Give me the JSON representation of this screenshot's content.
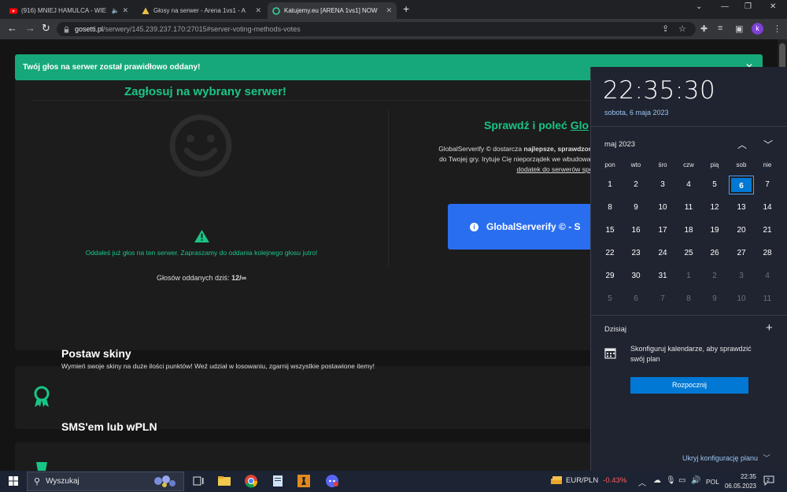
{
  "browser": {
    "tabs": [
      {
        "title": "(916) MNIEJ HAMULCA - WIE",
        "icon": "youtube-icon"
      },
      {
        "title": "Głosy na serwer - Arena 1vs1 - A",
        "icon": "warning-favicon-icon"
      },
      {
        "title": "Katujemy.eu [ARENA 1vs1] NOW",
        "icon": "katujemy-favicon-icon"
      }
    ],
    "url_host": "gosetti.pl",
    "url_path": "/serwery/145.239.237.170:27015#server-voting-methods-votes",
    "profile_initial": "k"
  },
  "alert": {
    "text": "Twój głos na serwer został prawidłowo oddany!"
  },
  "vote_panel": {
    "title": "Zagłosuj na wybrany serwer!",
    "voted_message": "Oddałeś już głos na ten serwer. Zapraszamy do oddania kolejnego głosu jutro!",
    "counter_label": "Głosów oddanych dziś:",
    "counter_value": "12/∞"
  },
  "globalserverify": {
    "title_prefix": "Sprawdź i poleć",
    "title_link": "Glo",
    "desc_1": "GlobalServerify © dostarcza",
    "desc_bold": "najlepsze, sprawdzone,",
    "desc_2": "do Twojej gry. Irytuje Cię nieporządek we wbudowane",
    "desc_link": "dodatek do serwerów społe",
    "button_label": "GlobalServerify © - S"
  },
  "skins": {
    "title": "Postaw skiny",
    "description": "Wymień swoje skiny na duże ilości punktów! Weź udział w losowaniu, zgarnij wszystkie postawione itemy!"
  },
  "sms": {
    "title": "SMS'em lub wPLN"
  },
  "calendar_flyout": {
    "time": "22:35:30",
    "date": "sobota, 6 maja 2023",
    "month_label": "maj 2023",
    "weekdays": [
      "pon",
      "wto",
      "śro",
      "czw",
      "pią",
      "sob",
      "nie"
    ],
    "days": [
      [
        "1",
        "2",
        "3",
        "4",
        "5",
        "6",
        "7"
      ],
      [
        "8",
        "9",
        "10",
        "11",
        "12",
        "13",
        "14"
      ],
      [
        "15",
        "16",
        "17",
        "18",
        "19",
        "20",
        "21"
      ],
      [
        "22",
        "23",
        "24",
        "25",
        "26",
        "27",
        "28"
      ],
      [
        "29",
        "30",
        "31",
        "1",
        "2",
        "3",
        "4"
      ],
      [
        "5",
        "6",
        "7",
        "8",
        "9",
        "10",
        "11"
      ]
    ],
    "today_label": "Dzisiaj",
    "config_text": "Skonfiguruj kalendarze, aby sprawdzić swój plan",
    "start_button": "Rozpocznij",
    "hide_config": "Ukryj konfigurację planu"
  },
  "taskbar": {
    "search_placeholder": "Wyszukaj",
    "ticker_symbol": "EUR/PLN",
    "ticker_change": "-0.43%",
    "language": "POL",
    "clock_time": "22:35",
    "clock_date": "06.05.2023",
    "notification_count": "2"
  },
  "colors": {
    "accent_green": "#19c586",
    "alert_green": "#16a87a",
    "button_blue": "#2a6ef0",
    "windows_blue": "#0078d4"
  }
}
